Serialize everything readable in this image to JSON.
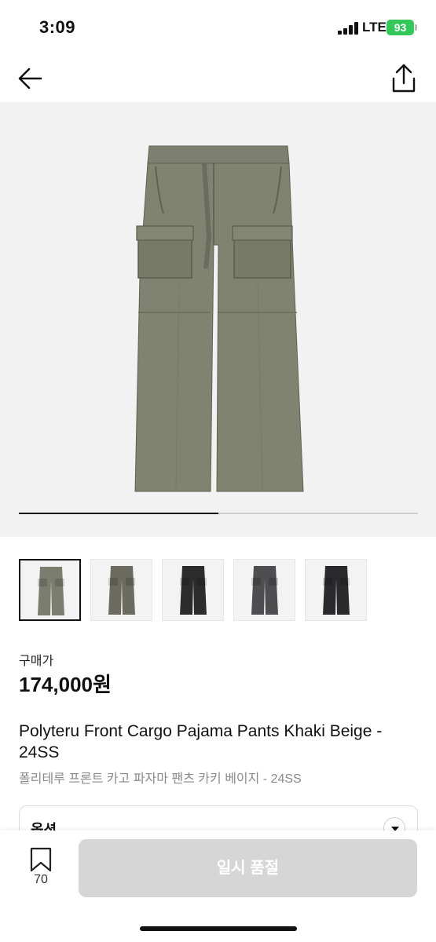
{
  "status_bar": {
    "time": "3:09",
    "network": "LTE",
    "battery": "93",
    "battery_color": "#34c759"
  },
  "nav": {
    "back_icon": "arrow-left-icon",
    "share_icon": "share-icon"
  },
  "gallery": {
    "image_icon": "cargo-pants-image",
    "progress": 0.5,
    "thumbnails": [
      {
        "name": "khaki",
        "color": "#7b7e6f",
        "selected": true
      },
      {
        "name": "olive-gray",
        "color": "#6c6b60",
        "selected": false
      },
      {
        "name": "black",
        "color": "#2c2c2c",
        "selected": false
      },
      {
        "name": "charcoal",
        "color": "#4e4d4f",
        "selected": false
      },
      {
        "name": "black-2",
        "color": "#2a2a2c",
        "selected": false
      }
    ]
  },
  "product": {
    "price_label": "구매가",
    "price": "174,000원",
    "title_en": "Polyteru Front Cargo Pajama Pants Khaki Beige - 24SS",
    "title_ko": "폴리테루 프론트 카고 파자마 팬츠 카키 베이지 - 24SS"
  },
  "option": {
    "label": "옵션",
    "chevron_icon": "chevron-down-icon"
  },
  "bottom_bar": {
    "bookmark_icon": "bookmark-icon",
    "bookmark_count": "70",
    "cta_label": "일시 품절",
    "cta_color": "#d6d6d6"
  }
}
